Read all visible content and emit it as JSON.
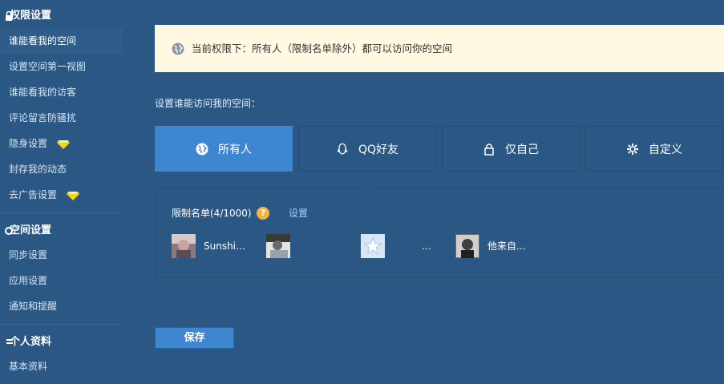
{
  "sidebar": {
    "sections": [
      {
        "title": "权限设置",
        "items": [
          "谁能看我的空间",
          "设置空间第一视图",
          "谁能看我的访客",
          "评论留言防骚扰",
          "隐身设置",
          "封存我的动态",
          "去广告设置"
        ]
      },
      {
        "title": "空间设置",
        "items": [
          "同步设置",
          "应用设置",
          "通知和提醒"
        ]
      },
      {
        "title": "个人资料",
        "items": [
          "基本资料"
        ]
      }
    ],
    "active_item": "谁能看我的空间",
    "gem_color": "#f5d31c"
  },
  "notice": {
    "text": "当前权限下：所有人（限制名单除外）都可以访问你的空间"
  },
  "visit_label": "设置谁能访问我的空间：",
  "tabs": [
    {
      "label": "所有人",
      "icon": "globe-icon",
      "active": true
    },
    {
      "label": "QQ好友",
      "icon": "qq-icon",
      "active": false
    },
    {
      "label": "仅自己",
      "icon": "lock-icon",
      "active": false
    },
    {
      "label": "自定义",
      "icon": "gear-icon",
      "active": false
    }
  ],
  "restrict": {
    "label": "限制名单(4/1000)",
    "help": "?",
    "settings_link": "设置",
    "members": [
      {
        "name": "Sunshi…",
        "avatar": "avatar-photo"
      },
      {
        "name": "",
        "avatar": "avatar-photo"
      },
      {
        "name": "…",
        "avatar": "star-avatar"
      },
      {
        "name": "他来自…",
        "avatar": "avatar-photo"
      }
    ]
  },
  "save_label": "保存",
  "colors": {
    "background": "#2a5783",
    "accent": "#3e86cf",
    "notice_bg": "#fff9e3"
  }
}
